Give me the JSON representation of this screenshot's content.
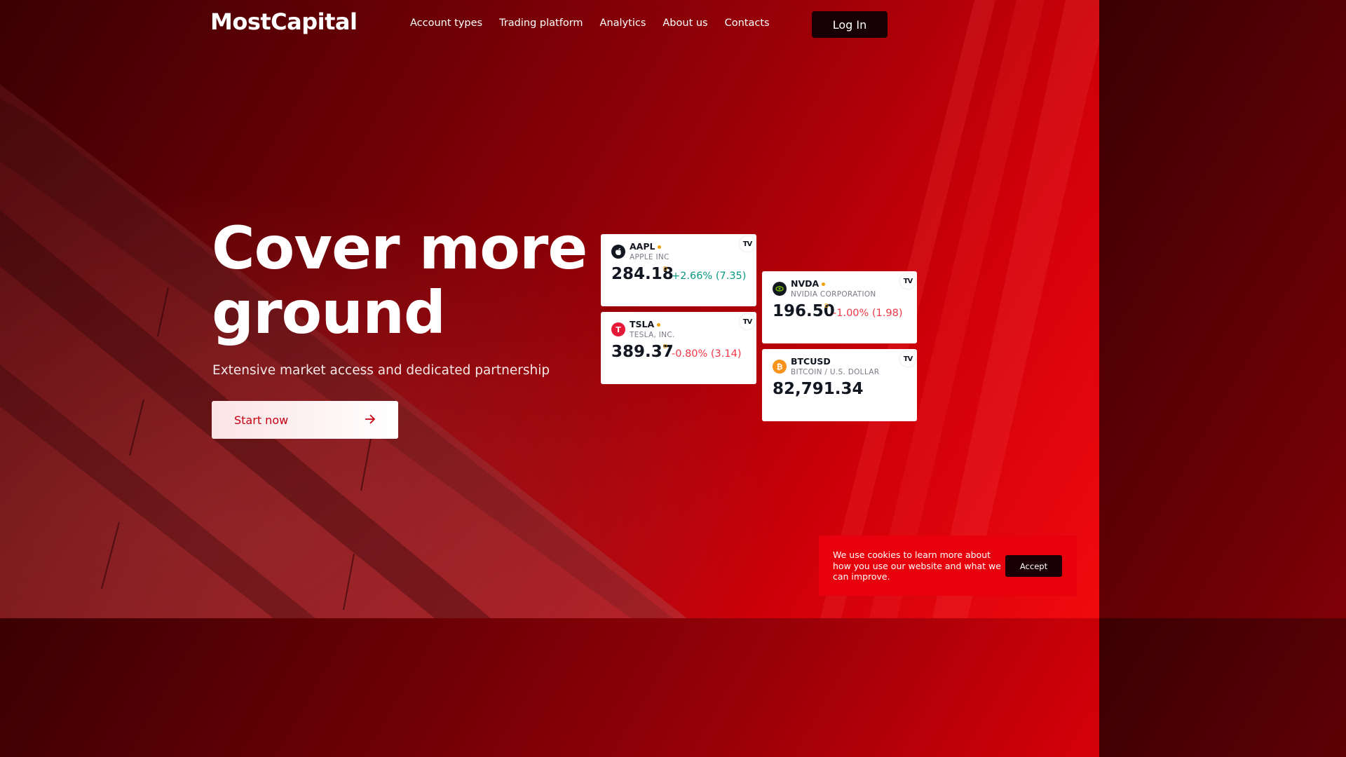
{
  "header": {
    "logo": "MostCapital",
    "nav": [
      "Account types",
      "Trading platform",
      "Analytics",
      "About us",
      "Contacts"
    ],
    "login_label": "Log In"
  },
  "hero": {
    "title_line1": "Cover more",
    "title_line2": "ground",
    "subtitle": "Extensive market access and dedicated partnership",
    "cta_label": "Start now",
    "cta_icon": "arrow-right-icon"
  },
  "tickers": [
    {
      "symbol": "AAPL",
      "name": "APPLE INC",
      "price": "284.18",
      "flag": "D",
      "change": "+2.66% (7.35)",
      "direction": "up",
      "icon": "apple-icon",
      "icon_color": "#131722",
      "icon_glyph": ""
    },
    {
      "symbol": "NVDA",
      "name": "NVIDIA CORPORATION",
      "price": "196.50",
      "flag": "D",
      "change": "-1.00% (1.98)",
      "direction": "down",
      "icon": "nvidia-icon",
      "icon_color": "#131722",
      "icon_glyph": ""
    },
    {
      "symbol": "TSLA",
      "name": "TESLA, INC.",
      "price": "389.37",
      "flag": "D",
      "change": "-0.80% (3.14)",
      "direction": "down",
      "icon": "tesla-icon",
      "icon_color": "#e31937",
      "icon_glyph": "T"
    },
    {
      "symbol": "BTCUSD",
      "name": "BITCOIN / U.S. DOLLAR",
      "price": "82,791.34",
      "flag": "",
      "change": "",
      "direction": "none",
      "icon": "bitcoin-icon",
      "icon_color": "#f7931a",
      "icon_glyph": "₿"
    }
  ],
  "tradingview_badge": "TV",
  "cookie": {
    "text": "We use cookies to learn more about how you use our website and what we can improve.",
    "accept_label": "Accept"
  },
  "colors": {
    "brand_red": "#e8000c",
    "up": "#089981",
    "down": "#f23645",
    "dark": "#160003"
  }
}
